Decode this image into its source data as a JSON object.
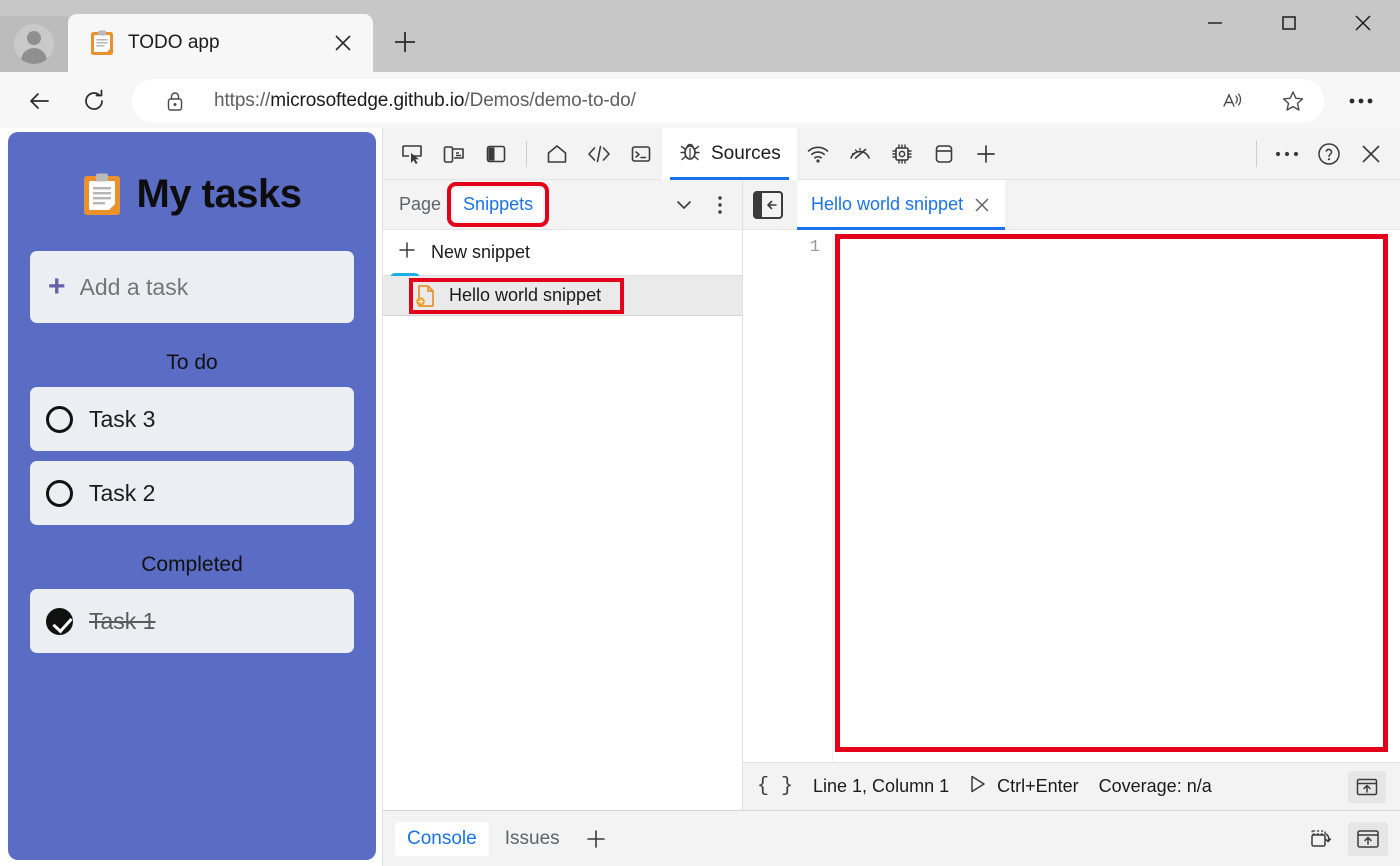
{
  "browser": {
    "tab": {
      "title": "TODO app",
      "favicon_icon": "clipboard-icon",
      "close_icon": "close-icon"
    },
    "new_tab_icon": "plus-icon",
    "window_controls": {
      "minimize": "minimize-icon",
      "maximize": "maximize-icon",
      "close": "close-icon"
    },
    "nav": {
      "back_icon": "back-arrow-icon",
      "reload_icon": "reload-icon"
    },
    "url": {
      "lock_icon": "lock-icon",
      "scheme": "https://",
      "host": "microsoftedge.github.io",
      "path": "/Demos/demo-to-do/",
      "read_aloud_icon": "read-aloud-icon",
      "favorite_icon": "star-icon"
    },
    "settings_icon": "ellipsis-icon"
  },
  "todo_app": {
    "title": "My tasks",
    "title_icon": "clipboard-icon",
    "add_task": {
      "placeholder": "Add a task",
      "plus_icon": "plus-icon",
      "submit_icon": "arrow-right-icon"
    },
    "sections": [
      {
        "label": "To do",
        "tasks": [
          {
            "label": "Task 3",
            "completed": false
          },
          {
            "label": "Task 2",
            "completed": false
          }
        ]
      },
      {
        "label": "Completed",
        "tasks": [
          {
            "label": "Task 1",
            "completed": true
          }
        ]
      }
    ],
    "accent_color": "#5b6cc4",
    "card_color": "#eceef3",
    "submit_color": "#19b0e8"
  },
  "devtools": {
    "toolbar_left_icons": [
      "inspect-icon",
      "device-toggle-icon",
      "dock-side-icon"
    ],
    "panels": [
      {
        "label": "Welcome",
        "icon": "home-icon",
        "active": false
      },
      {
        "label": "Elements",
        "icon": "code-icon",
        "active": false
      },
      {
        "label": "Console",
        "icon": "console-icon",
        "active": false
      },
      {
        "label": "Sources",
        "icon": "bug-icon",
        "active": true
      },
      {
        "label": "Network",
        "icon": "wifi-icon",
        "active": false
      },
      {
        "label": "Performance",
        "icon": "gauge-icon",
        "active": false
      },
      {
        "label": "Memory",
        "icon": "chip-icon",
        "active": false
      },
      {
        "label": "Application",
        "icon": "storage-icon",
        "active": false
      }
    ],
    "more_panels_icon": "plus-icon",
    "toolbar_right": {
      "more_tools_icon": "ellipsis-icon",
      "help_icon": "question-circle-icon",
      "close_icon": "close-icon"
    },
    "navigator": {
      "tabs": [
        {
          "label": "Page",
          "selected": false,
          "highlighted": false
        },
        {
          "label": "Snippets",
          "selected": true,
          "highlighted": true
        }
      ],
      "more_tabs_icon": "chevron-down-icon",
      "options_icon": "kebab-menu-icon",
      "new_snippet": {
        "label": "New snippet",
        "icon": "plus-icon"
      },
      "snippets": [
        {
          "name": "Hello world snippet",
          "icon": "snippet-file-icon",
          "selected": true,
          "highlighted": true
        }
      ]
    },
    "editor": {
      "back_icon": "collapse-navigator-icon",
      "tab": {
        "label": "Hello world snippet",
        "close_icon": "close-icon"
      },
      "line_numbers": [
        "1"
      ],
      "content": "",
      "content_highlighted": true,
      "status": {
        "pretty_print_icon": "curly-braces-icon",
        "pretty_print_label": "{ }",
        "cursor_position": "Line 1, Column 1",
        "run_icon": "play-icon",
        "run_shortcut": "Ctrl+Enter",
        "coverage": "Coverage: n/a",
        "open_drawer_icon": "show-drawer-icon"
      }
    },
    "drawer": {
      "tabs": [
        {
          "label": "Console",
          "selected": true
        },
        {
          "label": "Issues",
          "selected": false
        }
      ],
      "add_tab_icon": "plus-icon",
      "right_icons": [
        "restore-drawer-icon",
        "close-drawer-icon"
      ]
    },
    "highlight_color": "#e3001b",
    "accent_color": "#1a73e8"
  }
}
